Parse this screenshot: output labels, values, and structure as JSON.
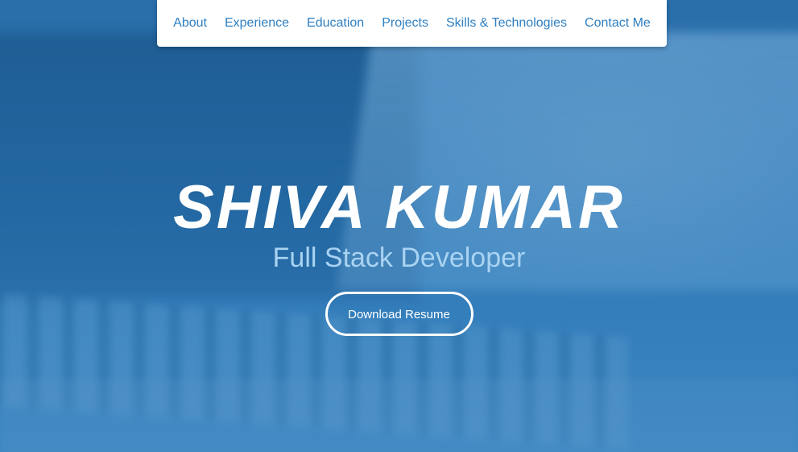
{
  "nav": {
    "items": [
      {
        "label": "About"
      },
      {
        "label": "Experience"
      },
      {
        "label": "Education"
      },
      {
        "label": "Projects"
      },
      {
        "label": "Skills & Technologies"
      },
      {
        "label": "Contact Me"
      }
    ]
  },
  "hero": {
    "name": "SHIVA KUMAR",
    "role": "Full Stack Developer",
    "resume_button": "Download Resume"
  },
  "colors": {
    "nav_link": "#2e7fc1",
    "hero_bg": "#2f7ab7",
    "role_text": "#a9d3f2"
  }
}
